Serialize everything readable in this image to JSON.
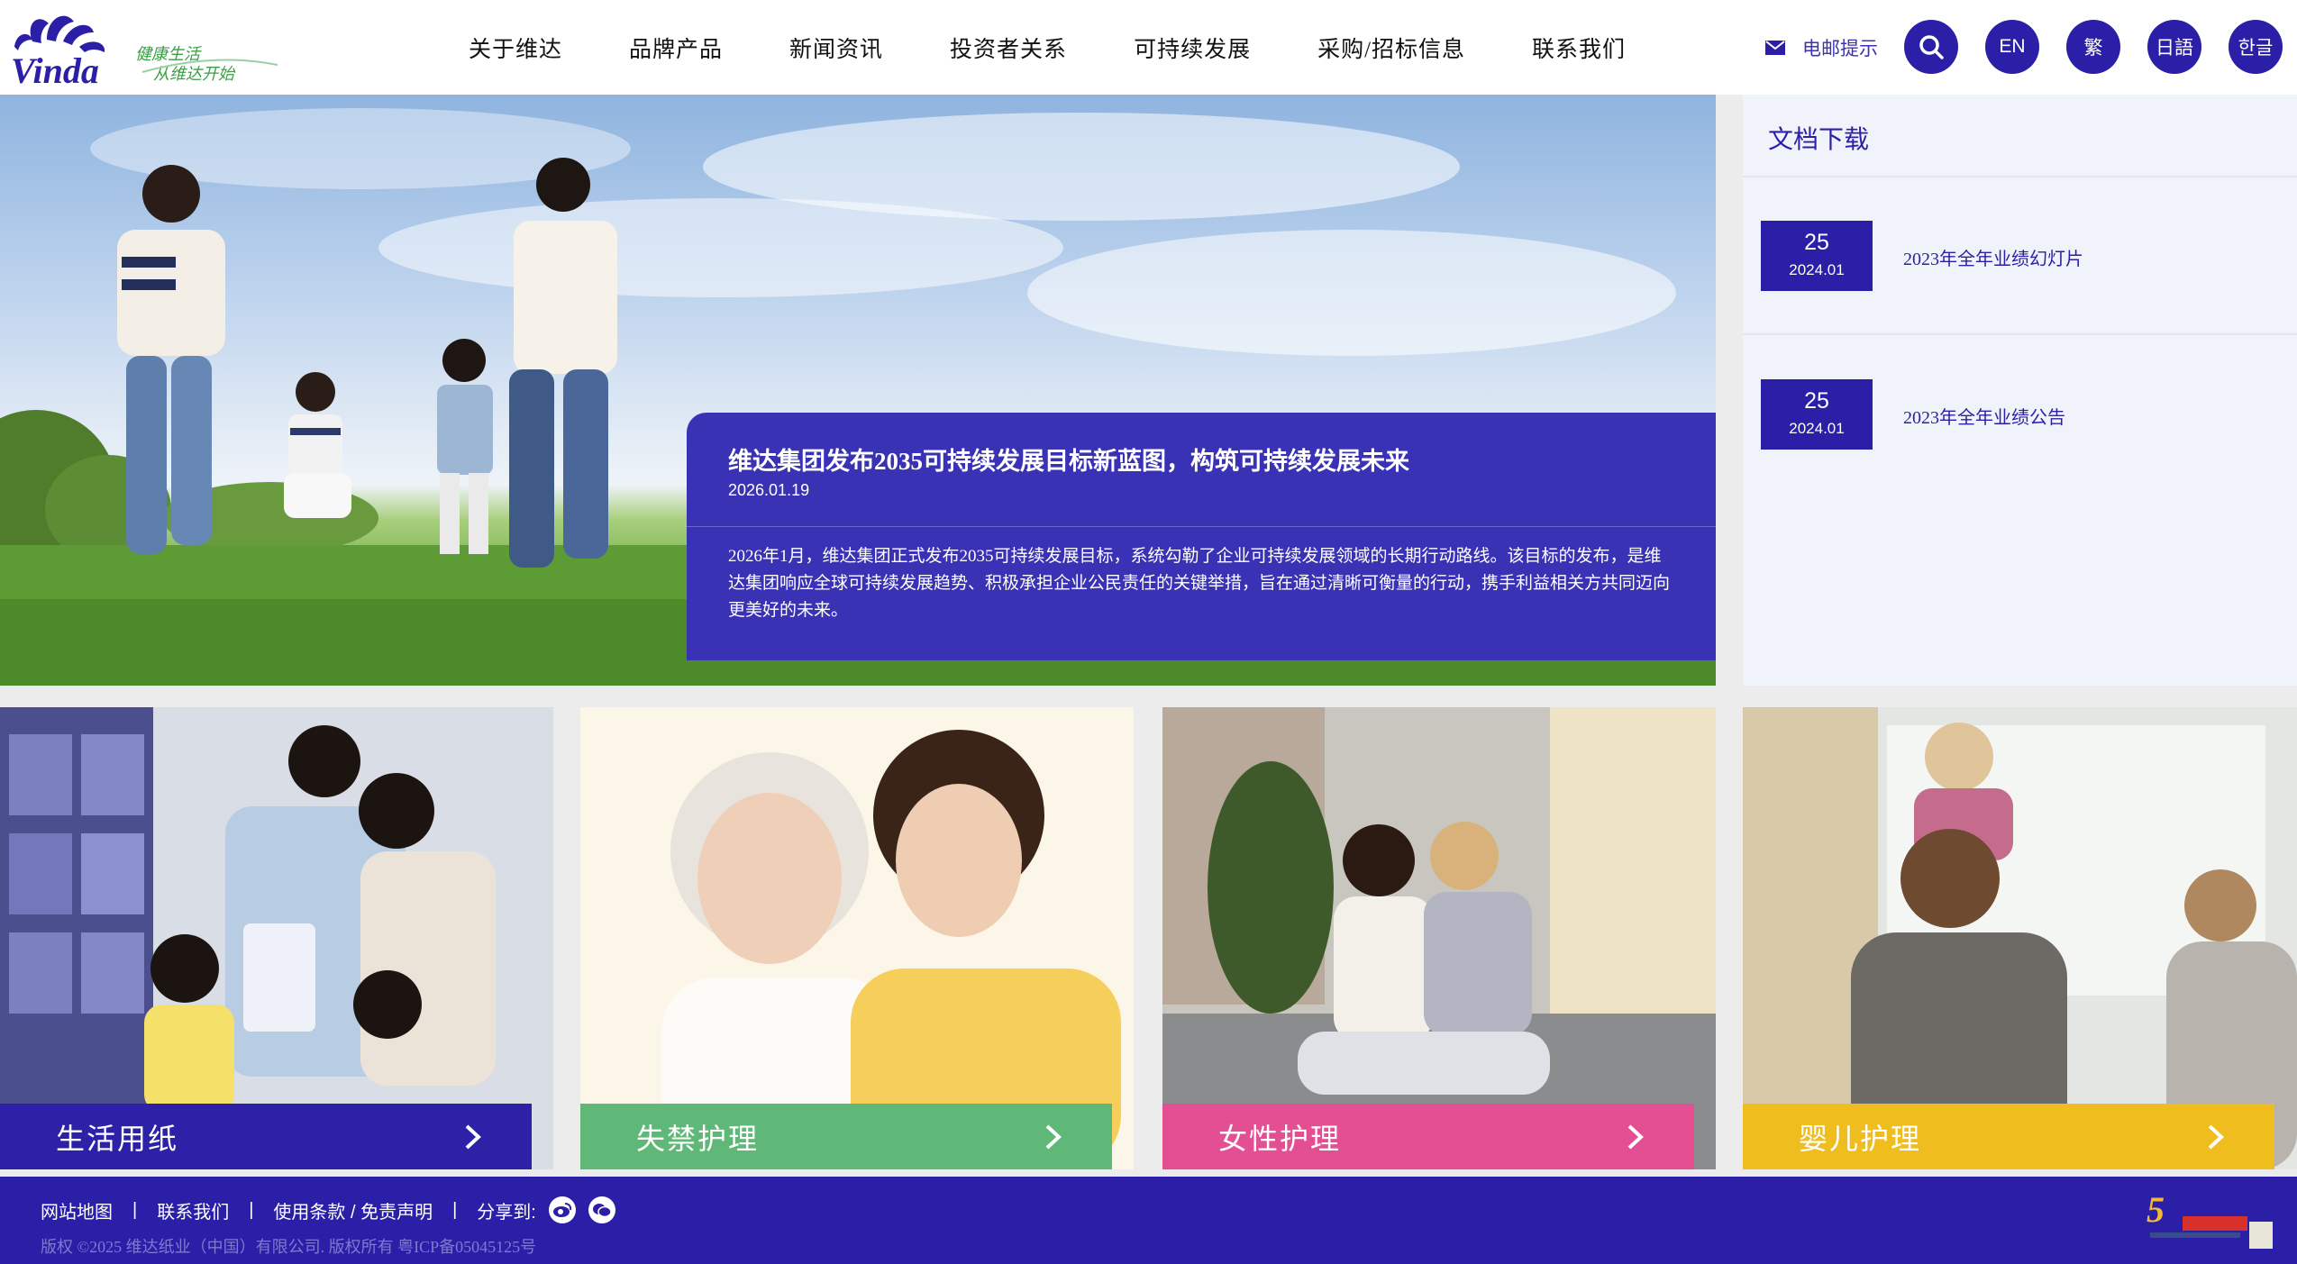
{
  "header": {
    "logo_brand": "Vinda",
    "logo_slogan_1": "健康生活",
    "logo_slogan_2": "从维达开始",
    "nav": [
      "关于维达",
      "品牌产品",
      "新闻资讯",
      "投资者关系",
      "可持续发展",
      "采购/招标信息",
      "联系我们"
    ],
    "email_alert": "电邮提示",
    "lang_en": "EN",
    "lang_tc": "繁",
    "lang_jp": "日語",
    "lang_kr": "한글",
    "accent_color": "#2a1fa6"
  },
  "hero": {
    "title": "维达集团发布2035可持续发展目标新蓝图，构筑可持续发展未来",
    "date": "2026.01.19",
    "body": "2026年1月，维达集团正式发布2035可持续发展目标，系统勾勒了企业可持续发展领域的长期行动路线。该目标的发布，是维达集团响应全球可持续发展趋势、积极承担企业公民责任的关键举措，旨在通过清晰可衡量的行动，携手利益相关方共同迈向更美好的未来。"
  },
  "docs": {
    "title": "文档下载",
    "items": [
      {
        "day": "25",
        "ym": "2024.01",
        "name": "2023年全年业绩幻灯片"
      },
      {
        "day": "25",
        "ym": "2024.01",
        "name": "2023年全年业绩公告"
      }
    ]
  },
  "categories": [
    {
      "label": "生活用纸",
      "color": "#2d22a7"
    },
    {
      "label": "失禁护理",
      "color": "#5fb877"
    },
    {
      "label": "女性护理",
      "color": "#e44f94"
    },
    {
      "label": "婴儿护理",
      "color": "#f0bd1e"
    }
  ],
  "footer": {
    "links": [
      "网站地图",
      "联系我们",
      "使用条款 / 免责声明"
    ],
    "share_label": "分享到:",
    "copyright": "版权 ©2025 维达纸业（中国）有限公司. 版权所有 粤ICP备05045125号"
  }
}
